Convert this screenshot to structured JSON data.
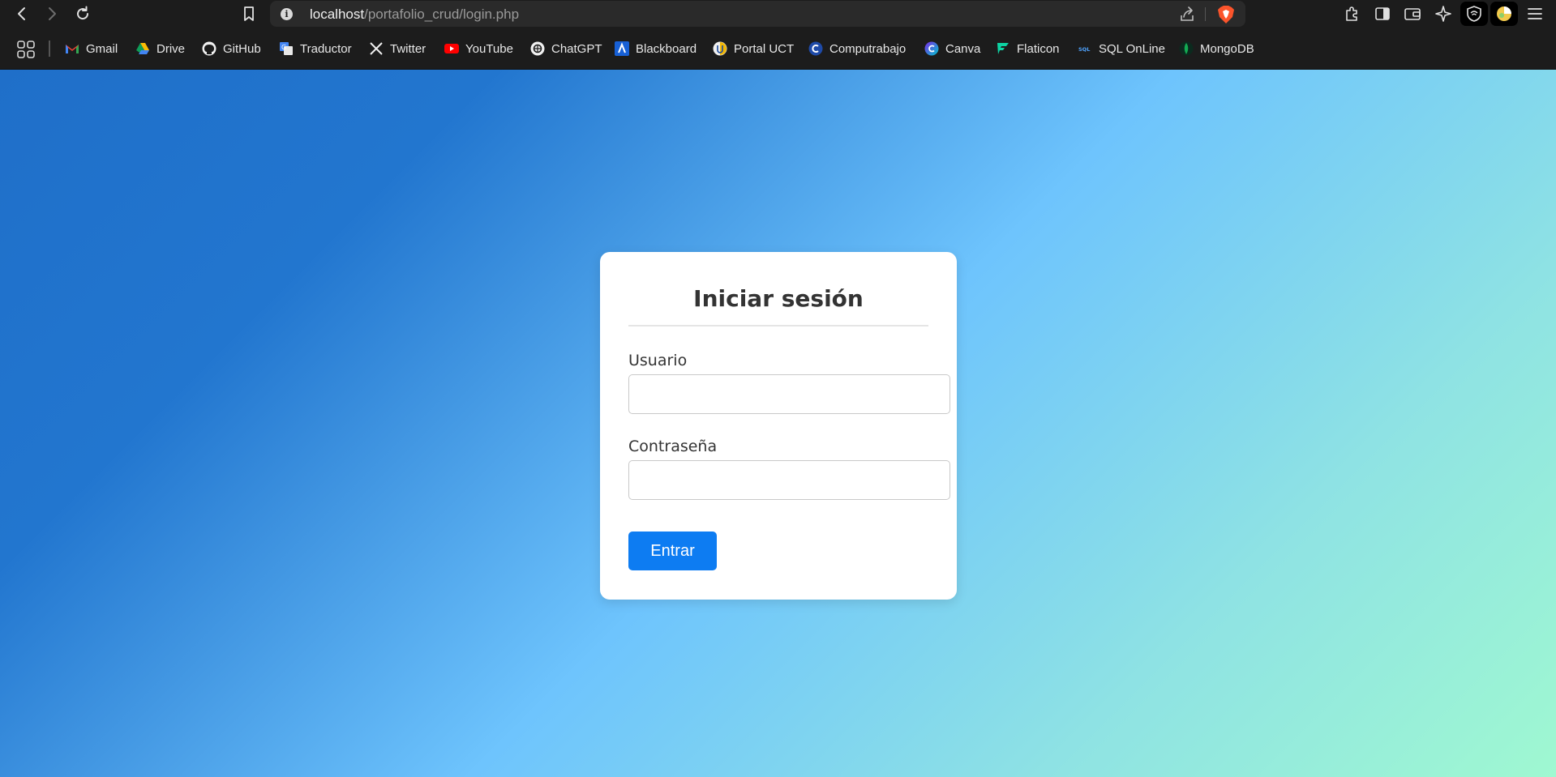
{
  "browser": {
    "url_host": "localhost",
    "url_path": "/portafolio_crud/login.php",
    "icons": [
      "back-icon",
      "forward-icon",
      "reload-icon",
      "bookmark-icon",
      "site-info-icon",
      "share-icon",
      "brave-shields-icon",
      "extensions-icon",
      "sidebar-icon",
      "wallet-icon",
      "leo-ai-icon",
      "vpn-icon",
      "profile-icon",
      "menu-icon"
    ]
  },
  "bookmarks": [
    {
      "label": "Gmail",
      "icon": "gmail-icon"
    },
    {
      "label": "Drive",
      "icon": "drive-icon"
    },
    {
      "label": "GitHub",
      "icon": "github-icon"
    },
    {
      "label": "Traductor",
      "icon": "translate-icon"
    },
    {
      "label": "Twitter",
      "icon": "x-icon"
    },
    {
      "label": "YouTube",
      "icon": "youtube-icon"
    },
    {
      "label": "ChatGPT",
      "icon": "chatgpt-icon"
    },
    {
      "label": "Blackboard",
      "icon": "blackboard-icon"
    },
    {
      "label": "Portal UCT",
      "icon": "uct-icon"
    },
    {
      "label": "Computrabajo",
      "icon": "computrabajo-icon"
    },
    {
      "label": "Canva",
      "icon": "canva-icon"
    },
    {
      "label": "Flaticon",
      "icon": "flaticon-icon"
    },
    {
      "label": "SQL OnLine",
      "icon": "sql-icon"
    },
    {
      "label": "MongoDB",
      "icon": "mongodb-icon"
    }
  ],
  "login": {
    "title": "Iniciar sesión",
    "user_label": "Usuario",
    "user_value": "",
    "password_label": "Contraseña",
    "password_value": "",
    "submit_label": "Entrar"
  },
  "colors": {
    "gradient_start": "#1f6fc9",
    "gradient_mid": "#6ec4fd",
    "gradient_end": "#9ff8d1",
    "button": "#0d7cf2"
  }
}
